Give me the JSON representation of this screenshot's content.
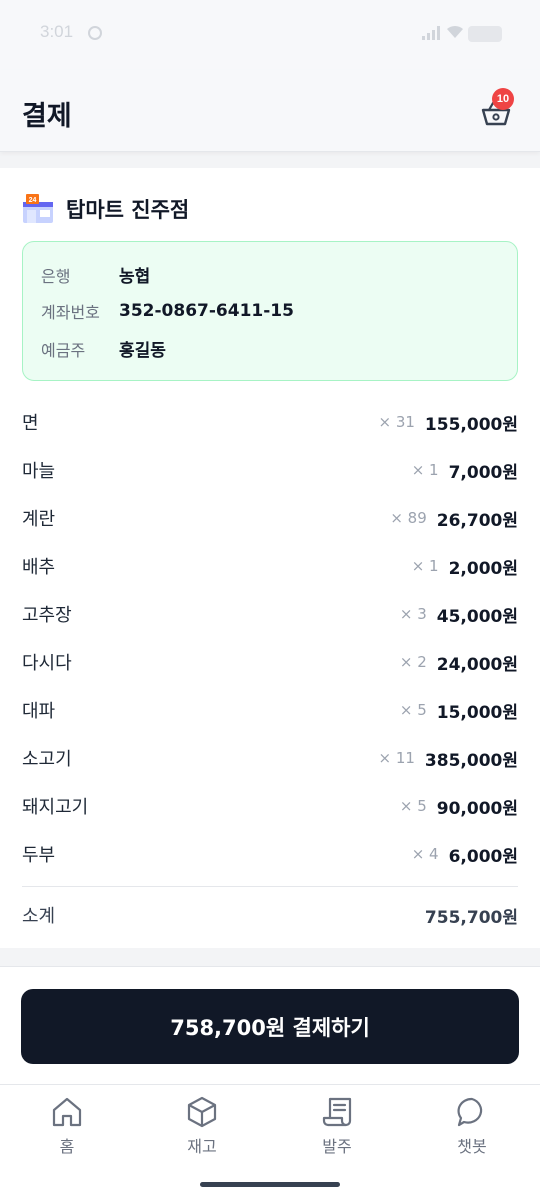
{
  "status_bar": {
    "time": "3:01"
  },
  "header": {
    "title": "결제",
    "cart_count": "10"
  },
  "store": {
    "name": "탑마트 진주점"
  },
  "bank": [
    {
      "label": "은행",
      "value": "농협"
    },
    {
      "label": "계좌번호",
      "value": "352-0867-6411-15"
    },
    {
      "label": "예금주",
      "value": "홍길동"
    }
  ],
  "items": [
    {
      "name": "면",
      "qty": "× 31",
      "price": "155,000원"
    },
    {
      "name": "마늘",
      "qty": "× 1",
      "price": "7,000원"
    },
    {
      "name": "계란",
      "qty": "× 89",
      "price": "26,700원"
    },
    {
      "name": "배추",
      "qty": "× 1",
      "price": "2,000원"
    },
    {
      "name": "고추장",
      "qty": "× 3",
      "price": "45,000원"
    },
    {
      "name": "다시다",
      "qty": "× 2",
      "price": "24,000원"
    },
    {
      "name": "대파",
      "qty": "× 5",
      "price": "15,000원"
    },
    {
      "name": "소고기",
      "qty": "× 11",
      "price": "385,000원"
    },
    {
      "name": "돼지고기",
      "qty": "× 5",
      "price": "90,000원"
    },
    {
      "name": "두부",
      "qty": "× 4",
      "price": "6,000원"
    }
  ],
  "subtotal": {
    "label": "소계",
    "value": "755,700원"
  },
  "pay_button": {
    "label": "758,700원 결제하기"
  },
  "tabs": [
    {
      "label": "홈",
      "icon": "home-icon"
    },
    {
      "label": "재고",
      "icon": "box-icon"
    },
    {
      "label": "발주",
      "icon": "scroll-icon"
    },
    {
      "label": "챗봇",
      "icon": "chat-bubble-icon"
    }
  ],
  "colors": {
    "primary": "#111827",
    "badge": "#ef4444",
    "bank_box_bg": "#ecfdf3",
    "bank_box_border": "#a7f3c5"
  }
}
